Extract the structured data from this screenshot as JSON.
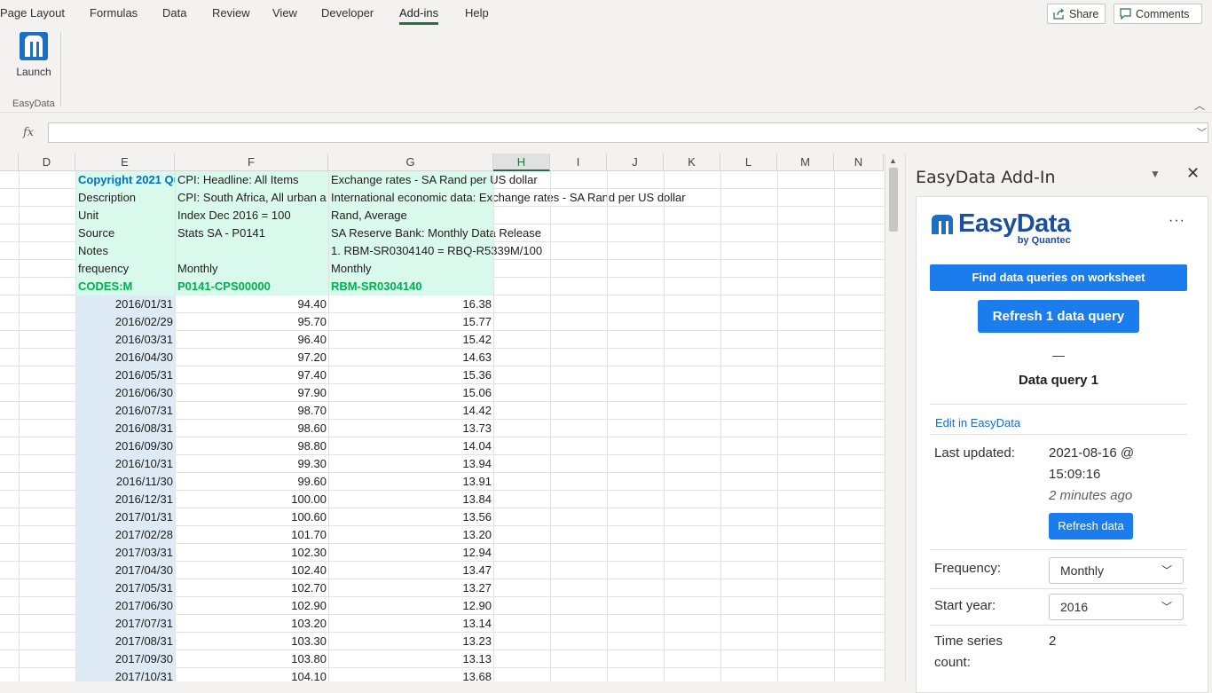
{
  "ribbon": {
    "tabs": [
      "Page Layout",
      "Formulas",
      "Data",
      "Review",
      "View",
      "Developer",
      "Add-ins",
      "Help"
    ],
    "active_tab": "Add-ins",
    "share_label": "Share",
    "comments_label": "Comments",
    "launch_label": "Launch",
    "group_label": "EasyData"
  },
  "formula_bar": {
    "fx": "fx",
    "value": ""
  },
  "sheet": {
    "columns": [
      "D",
      "E",
      "F",
      "G",
      "H",
      "I",
      "J",
      "K",
      "L",
      "M",
      "N"
    ],
    "selected_column": "H",
    "header_rows": [
      {
        "e": "Copyright 2021 Qu",
        "f": "CPI: Headline: All Items",
        "g": "Exchange rates - SA Rand per US dollar"
      },
      {
        "e": "Description",
        "f": "CPI: South Africa, All urban a",
        "g": "International economic data: Exchange rates - SA Rand per US dollar"
      },
      {
        "e": "Unit",
        "f": "Index Dec 2016 = 100",
        "g": "Rand, Average"
      },
      {
        "e": "Source",
        "f": "Stats SA - P0141",
        "g": "SA Reserve Bank: Monthly Data Release"
      },
      {
        "e": "Notes",
        "f": "",
        "g": "1. RBM-SR0304140 = RBQ-R5339M/100"
      },
      {
        "e": "frequency",
        "f": "Monthly",
        "g": "Monthly"
      },
      {
        "e": "CODES:M",
        "f": "P0141-CPS00000",
        "g": "RBM-SR0304140"
      }
    ],
    "data_rows": [
      [
        "2016/01/31",
        "94.40",
        "16.38"
      ],
      [
        "2016/02/29",
        "95.70",
        "15.77"
      ],
      [
        "2016/03/31",
        "96.40",
        "15.42"
      ],
      [
        "2016/04/30",
        "97.20",
        "14.63"
      ],
      [
        "2016/05/31",
        "97.40",
        "15.36"
      ],
      [
        "2016/06/30",
        "97.90",
        "15.06"
      ],
      [
        "2016/07/31",
        "98.70",
        "14.42"
      ],
      [
        "2016/08/31",
        "98.60",
        "13.73"
      ],
      [
        "2016/09/30",
        "98.80",
        "14.04"
      ],
      [
        "2016/10/31",
        "99.30",
        "13.94"
      ],
      [
        "2016/11/30",
        "99.60",
        "13.91"
      ],
      [
        "2016/12/31",
        "100.00",
        "13.84"
      ],
      [
        "2017/01/31",
        "100.60",
        "13.56"
      ],
      [
        "2017/02/28",
        "101.70",
        "13.20"
      ],
      [
        "2017/03/31",
        "102.30",
        "12.94"
      ],
      [
        "2017/04/30",
        "102.40",
        "13.47"
      ],
      [
        "2017/05/31",
        "102.70",
        "13.27"
      ],
      [
        "2017/06/30",
        "102.90",
        "12.90"
      ],
      [
        "2017/07/31",
        "103.20",
        "13.14"
      ],
      [
        "2017/08/31",
        "103.30",
        "13.23"
      ],
      [
        "2017/09/30",
        "103.80",
        "13.13"
      ],
      [
        "2017/10/31",
        "104.10",
        "13.68"
      ]
    ]
  },
  "pane": {
    "title": "EasyData Add-In",
    "logo_main": "EasyData",
    "logo_sub": "by Quantec",
    "find_button": "Find data queries on worksheet",
    "refresh_button": "Refresh 1 data query",
    "dash": "—",
    "query_title": "Data query 1",
    "edit_link": "Edit in EasyData",
    "last_updated_label": "Last updated:",
    "last_updated_value": "2021-08-16 @",
    "last_updated_time": "15:09:16",
    "last_updated_ago": "2 minutes ago",
    "refresh_data_button": "Refresh data",
    "frequency_label": "Frequency:",
    "frequency_value": "Monthly",
    "start_year_label": "Start year:",
    "start_year_value": "2016",
    "series_count_label_1": "Time series",
    "series_count_label_2": "count:",
    "series_count_value": "2"
  },
  "colors": {
    "header_fill": "#d9f9ec",
    "date_fill": "#deebf7",
    "code_green": "#00b050",
    "copyright_blue": "#0070c0",
    "button_blue": "#1b7ded",
    "logo_blue": "#1d4f9c"
  }
}
